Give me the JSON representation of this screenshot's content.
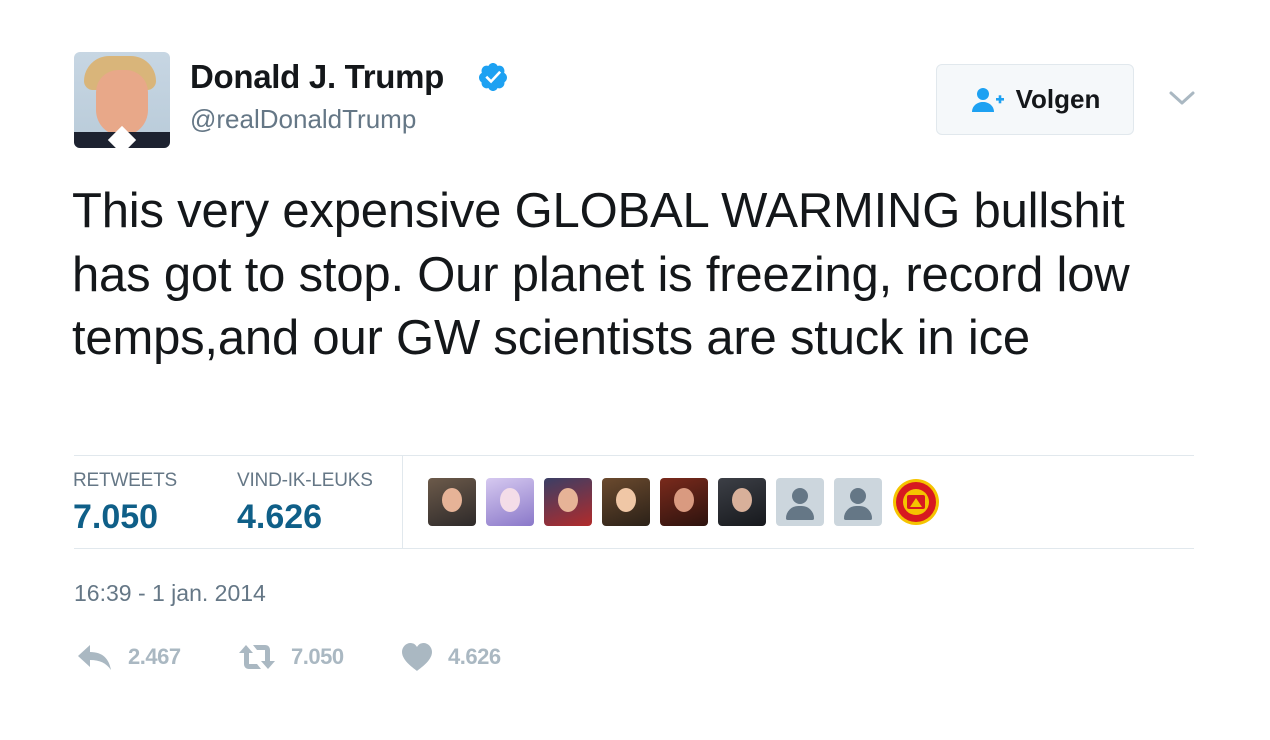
{
  "author": {
    "name": "Donald J. Trump",
    "handle": "@realDonaldTrump",
    "verified": true
  },
  "follow_button": {
    "label": "Volgen",
    "icon": "add-user-icon"
  },
  "tweet": {
    "text": "This very expensive GLOBAL WARMING bullshit has got to stop. Our planet is freezing, record low temps,and our GW scientists are stuck in ice",
    "timestamp": "16:39 - 1 jan. 2014"
  },
  "stats": {
    "retweets_label": "RETWEETS",
    "retweets_value": "7.050",
    "likes_label": "VIND-IK-LEUKS",
    "likes_value": "4.626"
  },
  "likers": [
    {
      "type": "photo",
      "icon": "user-avatar"
    },
    {
      "type": "photo",
      "icon": "user-avatar"
    },
    {
      "type": "photo",
      "icon": "user-avatar"
    },
    {
      "type": "photo",
      "icon": "user-avatar"
    },
    {
      "type": "photo",
      "icon": "user-avatar"
    },
    {
      "type": "photo",
      "icon": "user-avatar"
    },
    {
      "type": "default",
      "icon": "default-avatar-icon"
    },
    {
      "type": "default",
      "icon": "default-avatar-icon"
    },
    {
      "type": "crest",
      "icon": "club-crest-icon"
    }
  ],
  "actions": {
    "reply_count": "2.467",
    "retweet_count": "7.050",
    "like_count": "4.626"
  },
  "colors": {
    "verified_blue": "#1da1f2",
    "stat_value": "#0f5f88",
    "muted_text": "#657786",
    "action_gray": "#aab8c2",
    "border": "#e1e8ed"
  }
}
